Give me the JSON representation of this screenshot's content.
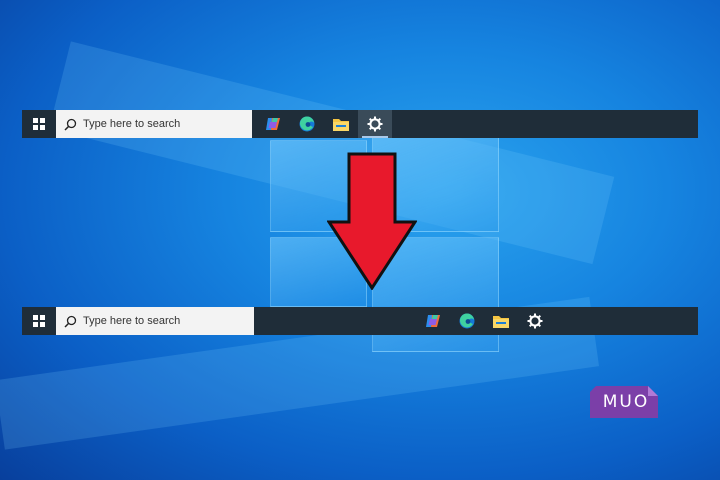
{
  "colors": {
    "taskbar": "#1f2d39",
    "search_box": "#f3f3f3",
    "arrow": "#e8192c",
    "watermark_bg": "#7b3fa8"
  },
  "taskbar_before": {
    "alignment": "left",
    "search": {
      "placeholder": "Type here to search",
      "icon": "search-icon"
    },
    "pinned_apps": [
      {
        "name": "Copilot",
        "icon": "copilot-icon"
      },
      {
        "name": "Microsoft Edge",
        "icon": "edge-icon"
      },
      {
        "name": "File Explorer",
        "icon": "file-explorer-icon"
      },
      {
        "name": "Settings",
        "icon": "settings-icon",
        "active": true
      }
    ]
  },
  "taskbar_after": {
    "alignment": "center",
    "search": {
      "placeholder": "Type here to search",
      "icon": "search-icon"
    },
    "pinned_apps": [
      {
        "name": "Copilot",
        "icon": "copilot-icon"
      },
      {
        "name": "Microsoft Edge",
        "icon": "edge-icon"
      },
      {
        "name": "File Explorer",
        "icon": "file-explorer-icon"
      },
      {
        "name": "Settings",
        "icon": "settings-icon"
      }
    ]
  },
  "watermark": {
    "text": "MUO"
  }
}
